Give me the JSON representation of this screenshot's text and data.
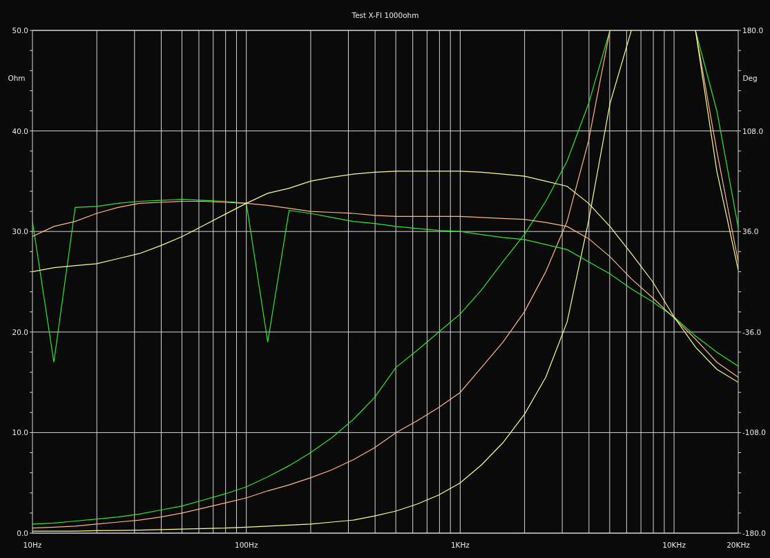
{
  "chart": {
    "right_axis": {
      "title": "Deg",
      "labels": [
        "180.0",
        "108.0",
        "36.0",
        "-36.0",
        "-108.0",
        "-180.0"
      ]
    },
    "chart_data": {
      "type": "line",
      "grid": true,
      "title": "Test X-FI 1000ohm",
      "ylabel": "Ohm",
      "ylim": [
        0,
        50
      ],
      "yticks": [
        {
          "value": 0,
          "label": "0.0"
        },
        {
          "value": 10,
          "label": "10.0"
        },
        {
          "value": 20,
          "label": "20.0"
        },
        {
          "value": 30,
          "label": "30.0"
        },
        {
          "value": 40,
          "label": "40.0"
        },
        {
          "value": 50,
          "label": "50.0"
        }
      ],
      "categories": [
        "10Hz",
        null,
        null,
        null,
        null,
        null,
        null,
        null,
        null,
        null,
        "100Hz",
        null,
        null,
        null,
        null,
        null,
        null,
        null,
        null,
        null,
        "1KHz",
        null,
        null,
        null,
        null,
        null,
        null,
        null,
        null,
        null,
        "10KHz",
        null,
        null,
        "20KHz"
      ],
      "series": [
        {
          "color": "#30e830",
          "values": [
            0.9,
            1.0,
            1.2,
            1.4,
            1.6,
            1.9,
            2.3,
            2.7,
            3.3,
            3.9,
            4.6,
            5.6,
            6.7,
            8,
            9.5,
            11.3,
            13.5,
            16.5,
            18.2,
            20,
            21.8,
            24.2,
            27,
            29.7,
            33,
            37,
            42.7,
            50,
            null,
            null,
            null,
            50,
            42,
            30.4
          ]
        },
        {
          "color": "#ffb888",
          "values": [
            0.5,
            0.6,
            0.7,
            0.9,
            1.1,
            1.3,
            1.6,
            2,
            2.5,
            3,
            3.5,
            4.2,
            4.8,
            5.5,
            6.3,
            7.3,
            8.5,
            10,
            11.2,
            12.5,
            14,
            16.5,
            19,
            22,
            26,
            31,
            39,
            50,
            null,
            null,
            null,
            50,
            38,
            27
          ]
        },
        {
          "color": "#ffff90",
          "values": [
            0.2,
            0.2,
            0.2,
            0.25,
            0.27,
            0.3,
            0.35,
            0.4,
            0.45,
            0.5,
            0.6,
            0.7,
            0.8,
            0.9,
            1.1,
            1.3,
            1.7,
            2.2,
            2.9,
            3.8,
            5,
            6.8,
            9,
            11.8,
            15.5,
            21,
            31,
            42.7,
            50,
            null,
            null,
            50,
            36,
            26.2
          ]
        },
        {
          "color": "#30e830",
          "values": [
            31,
            17,
            32.4,
            32.5,
            32.8,
            33,
            33.1,
            33.2,
            33.1,
            33,
            32.8,
            19,
            32.1,
            31.8,
            31.4,
            31,
            30.8,
            30.5,
            30.3,
            30.1,
            30,
            29.7,
            29.4,
            29.2,
            28.7,
            28.2,
            27,
            25.8,
            24.3,
            23,
            21.5,
            19.6,
            18,
            16.6
          ]
        },
        {
          "color": "#ffb888",
          "values": [
            29.5,
            30.5,
            31,
            31.8,
            32.4,
            32.8,
            32.9,
            33,
            33,
            32.9,
            32.8,
            32.6,
            32.3,
            32,
            31.9,
            31.8,
            31.6,
            31.5,
            31.5,
            31.5,
            31.5,
            31.4,
            31.3,
            31.2,
            30.9,
            30.5,
            29.3,
            27.5,
            25.3,
            23.4,
            21.4,
            19.3,
            17,
            15.5
          ]
        },
        {
          "color": "#ffff90",
          "values": [
            26,
            26.4,
            26.6,
            26.8,
            27.3,
            27.8,
            28.6,
            29.5,
            30.6,
            31.7,
            32.8,
            33.8,
            34.3,
            35,
            35.4,
            35.7,
            35.9,
            36,
            36,
            36,
            36,
            35.9,
            35.7,
            35.5,
            35,
            34.5,
            32.8,
            30.5,
            27.8,
            25,
            21.5,
            18.5,
            16.3,
            15
          ]
        }
      ]
    }
  }
}
